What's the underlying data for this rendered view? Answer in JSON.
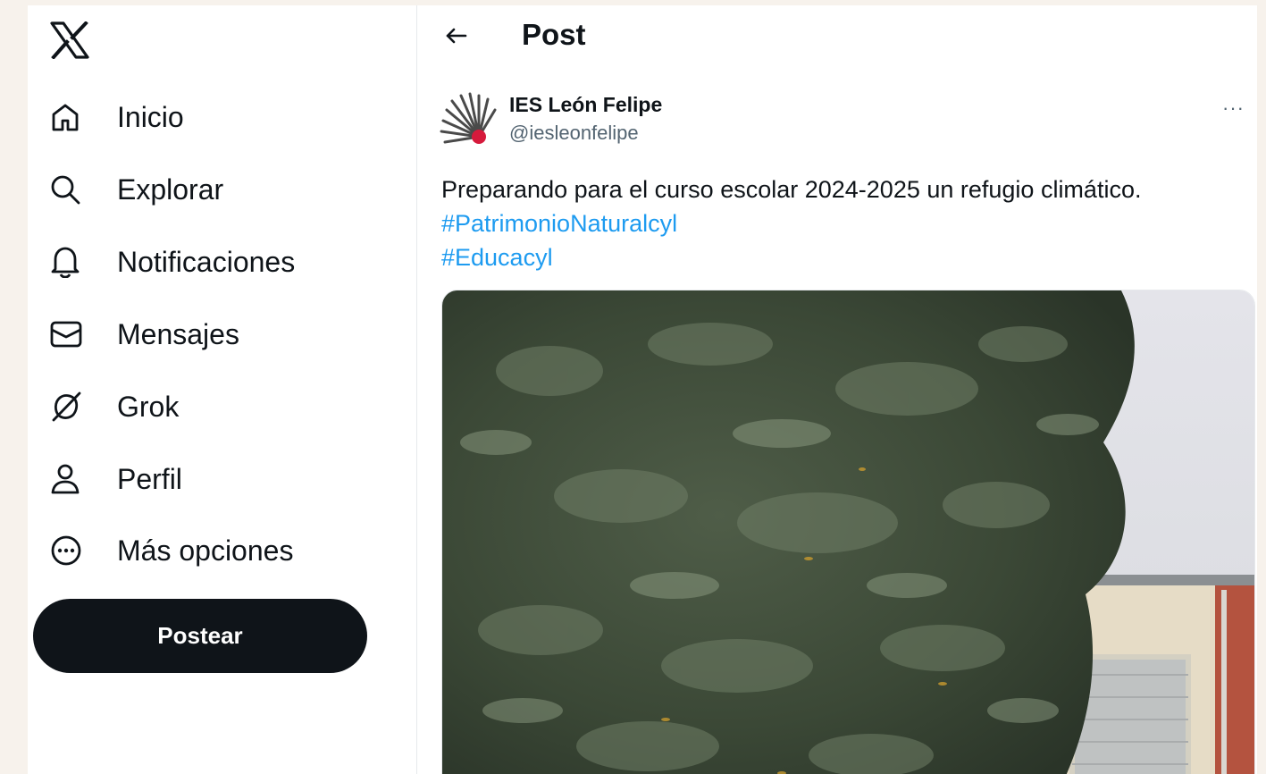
{
  "app": {
    "logo": "x-logo"
  },
  "sidebar": {
    "items": [
      {
        "label": "Inicio",
        "icon": "home-icon"
      },
      {
        "label": "Explorar",
        "icon": "search-icon"
      },
      {
        "label": "Notificaciones",
        "icon": "bell-icon"
      },
      {
        "label": "Mensajes",
        "icon": "mail-icon"
      },
      {
        "label": "Grok",
        "icon": "grok-icon"
      },
      {
        "label": "Perfil",
        "icon": "person-icon"
      },
      {
        "label": "Más opciones",
        "icon": "more-circle-icon"
      }
    ],
    "post_button": "Postear"
  },
  "header": {
    "title": "Post",
    "back_icon": "back-arrow-icon"
  },
  "post": {
    "author_name": "IES León Felipe",
    "author_handle": "@iesleonfelipe",
    "more": "···",
    "text": "Preparando para el curso escolar 2024-2025 un refugio climático.",
    "hashtags": [
      "#PatrimonioNaturalcyl",
      "#Educacyl"
    ],
    "media": "photo"
  },
  "colors": {
    "accent": "#1d9bf0",
    "text": "#0f1419",
    "muted": "#536471",
    "button": "#0f1419"
  }
}
